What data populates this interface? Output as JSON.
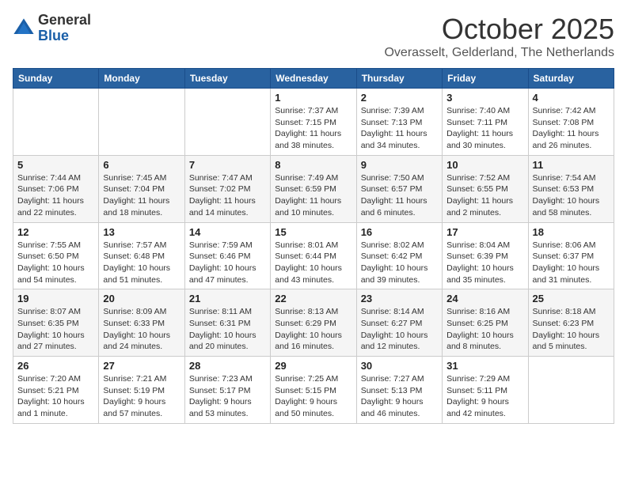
{
  "header": {
    "logo_line1": "General",
    "logo_line2": "Blue",
    "month": "October 2025",
    "location": "Overasselt, Gelderland, The Netherlands"
  },
  "weekdays": [
    "Sunday",
    "Monday",
    "Tuesday",
    "Wednesday",
    "Thursday",
    "Friday",
    "Saturday"
  ],
  "weeks": [
    [
      {
        "day": "",
        "info": ""
      },
      {
        "day": "",
        "info": ""
      },
      {
        "day": "",
        "info": ""
      },
      {
        "day": "1",
        "info": "Sunrise: 7:37 AM\nSunset: 7:15 PM\nDaylight: 11 hours\nand 38 minutes."
      },
      {
        "day": "2",
        "info": "Sunrise: 7:39 AM\nSunset: 7:13 PM\nDaylight: 11 hours\nand 34 minutes."
      },
      {
        "day": "3",
        "info": "Sunrise: 7:40 AM\nSunset: 7:11 PM\nDaylight: 11 hours\nand 30 minutes."
      },
      {
        "day": "4",
        "info": "Sunrise: 7:42 AM\nSunset: 7:08 PM\nDaylight: 11 hours\nand 26 minutes."
      }
    ],
    [
      {
        "day": "5",
        "info": "Sunrise: 7:44 AM\nSunset: 7:06 PM\nDaylight: 11 hours\nand 22 minutes."
      },
      {
        "day": "6",
        "info": "Sunrise: 7:45 AM\nSunset: 7:04 PM\nDaylight: 11 hours\nand 18 minutes."
      },
      {
        "day": "7",
        "info": "Sunrise: 7:47 AM\nSunset: 7:02 PM\nDaylight: 11 hours\nand 14 minutes."
      },
      {
        "day": "8",
        "info": "Sunrise: 7:49 AM\nSunset: 6:59 PM\nDaylight: 11 hours\nand 10 minutes."
      },
      {
        "day": "9",
        "info": "Sunrise: 7:50 AM\nSunset: 6:57 PM\nDaylight: 11 hours\nand 6 minutes."
      },
      {
        "day": "10",
        "info": "Sunrise: 7:52 AM\nSunset: 6:55 PM\nDaylight: 11 hours\nand 2 minutes."
      },
      {
        "day": "11",
        "info": "Sunrise: 7:54 AM\nSunset: 6:53 PM\nDaylight: 10 hours\nand 58 minutes."
      }
    ],
    [
      {
        "day": "12",
        "info": "Sunrise: 7:55 AM\nSunset: 6:50 PM\nDaylight: 10 hours\nand 54 minutes."
      },
      {
        "day": "13",
        "info": "Sunrise: 7:57 AM\nSunset: 6:48 PM\nDaylight: 10 hours\nand 51 minutes."
      },
      {
        "day": "14",
        "info": "Sunrise: 7:59 AM\nSunset: 6:46 PM\nDaylight: 10 hours\nand 47 minutes."
      },
      {
        "day": "15",
        "info": "Sunrise: 8:01 AM\nSunset: 6:44 PM\nDaylight: 10 hours\nand 43 minutes."
      },
      {
        "day": "16",
        "info": "Sunrise: 8:02 AM\nSunset: 6:42 PM\nDaylight: 10 hours\nand 39 minutes."
      },
      {
        "day": "17",
        "info": "Sunrise: 8:04 AM\nSunset: 6:39 PM\nDaylight: 10 hours\nand 35 minutes."
      },
      {
        "day": "18",
        "info": "Sunrise: 8:06 AM\nSunset: 6:37 PM\nDaylight: 10 hours\nand 31 minutes."
      }
    ],
    [
      {
        "day": "19",
        "info": "Sunrise: 8:07 AM\nSunset: 6:35 PM\nDaylight: 10 hours\nand 27 minutes."
      },
      {
        "day": "20",
        "info": "Sunrise: 8:09 AM\nSunset: 6:33 PM\nDaylight: 10 hours\nand 24 minutes."
      },
      {
        "day": "21",
        "info": "Sunrise: 8:11 AM\nSunset: 6:31 PM\nDaylight: 10 hours\nand 20 minutes."
      },
      {
        "day": "22",
        "info": "Sunrise: 8:13 AM\nSunset: 6:29 PM\nDaylight: 10 hours\nand 16 minutes."
      },
      {
        "day": "23",
        "info": "Sunrise: 8:14 AM\nSunset: 6:27 PM\nDaylight: 10 hours\nand 12 minutes."
      },
      {
        "day": "24",
        "info": "Sunrise: 8:16 AM\nSunset: 6:25 PM\nDaylight: 10 hours\nand 8 minutes."
      },
      {
        "day": "25",
        "info": "Sunrise: 8:18 AM\nSunset: 6:23 PM\nDaylight: 10 hours\nand 5 minutes."
      }
    ],
    [
      {
        "day": "26",
        "info": "Sunrise: 7:20 AM\nSunset: 5:21 PM\nDaylight: 10 hours\nand 1 minute."
      },
      {
        "day": "27",
        "info": "Sunrise: 7:21 AM\nSunset: 5:19 PM\nDaylight: 9 hours\nand 57 minutes."
      },
      {
        "day": "28",
        "info": "Sunrise: 7:23 AM\nSunset: 5:17 PM\nDaylight: 9 hours\nand 53 minutes."
      },
      {
        "day": "29",
        "info": "Sunrise: 7:25 AM\nSunset: 5:15 PM\nDaylight: 9 hours\nand 50 minutes."
      },
      {
        "day": "30",
        "info": "Sunrise: 7:27 AM\nSunset: 5:13 PM\nDaylight: 9 hours\nand 46 minutes."
      },
      {
        "day": "31",
        "info": "Sunrise: 7:29 AM\nSunset: 5:11 PM\nDaylight: 9 hours\nand 42 minutes."
      },
      {
        "day": "",
        "info": ""
      }
    ]
  ]
}
